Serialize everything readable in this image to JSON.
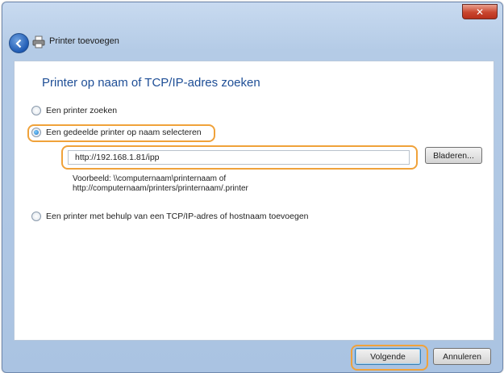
{
  "window": {
    "title": "Printer toevoegen",
    "close_label": "✕"
  },
  "main": {
    "heading": "Printer op naam of TCP/IP-adres zoeken",
    "options": [
      {
        "label": "Een printer zoeken",
        "checked": false
      },
      {
        "label": "Een gedeelde printer op naam selecteren",
        "checked": true
      },
      {
        "label": "Een printer met behulp van een TCP/IP-adres of hostnaam toevoegen",
        "checked": false
      }
    ],
    "url_value": "http://192.168.1.81/ipp",
    "browse_label": "Bladeren...",
    "example_line1": "Voorbeeld: \\\\computernaam\\printernaam of",
    "example_line2": "http://computernaam/printers/printernaam/.printer"
  },
  "footer": {
    "next_label": "Volgende",
    "cancel_label": "Annuleren"
  },
  "colors": {
    "highlight": "#f0a23a",
    "heading": "#1e4e96"
  }
}
